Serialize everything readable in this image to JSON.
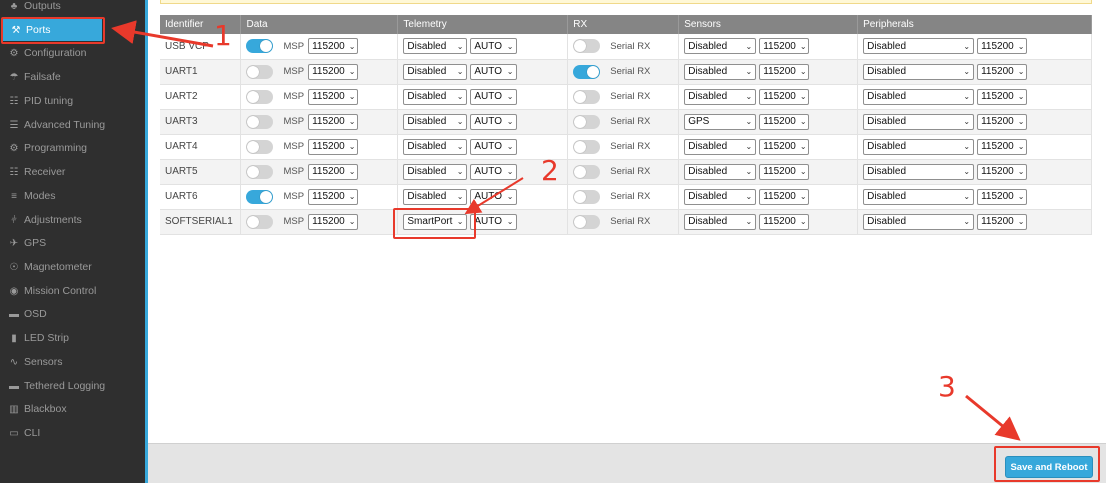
{
  "sidebar": {
    "items": [
      {
        "label": "Outputs",
        "icon": "outputs-icon",
        "glyph": "♣"
      },
      {
        "label": "Ports",
        "icon": "ports-icon",
        "glyph": "⚒",
        "active": true
      },
      {
        "label": "Configuration",
        "icon": "gear-icon",
        "glyph": "⚙"
      },
      {
        "label": "Failsafe",
        "icon": "failsafe-icon",
        "glyph": "☂"
      },
      {
        "label": "PID tuning",
        "icon": "pid-icon",
        "glyph": "☷"
      },
      {
        "label": "Advanced Tuning",
        "icon": "advanced-tuning-icon",
        "glyph": "☰"
      },
      {
        "label": "Programming",
        "icon": "programming-icon",
        "glyph": "⚙"
      },
      {
        "label": "Receiver",
        "icon": "receiver-icon",
        "glyph": "☷"
      },
      {
        "label": "Modes",
        "icon": "modes-icon",
        "glyph": "≡"
      },
      {
        "label": "Adjustments",
        "icon": "adjustments-icon",
        "glyph": "⫩"
      },
      {
        "label": "GPS",
        "icon": "gps-icon",
        "glyph": "✈"
      },
      {
        "label": "Magnetometer",
        "icon": "compass-icon",
        "glyph": "☉"
      },
      {
        "label": "Mission Control",
        "icon": "map-pin-icon",
        "glyph": "◉"
      },
      {
        "label": "OSD",
        "icon": "osd-icon",
        "glyph": "▬"
      },
      {
        "label": "LED Strip",
        "icon": "led-icon",
        "glyph": "▮"
      },
      {
        "label": "Sensors",
        "icon": "sensors-icon",
        "glyph": "∿"
      },
      {
        "label": "Tethered Logging",
        "icon": "logging-icon",
        "glyph": "▬"
      },
      {
        "label": "Blackbox",
        "icon": "blackbox-icon",
        "glyph": "▥"
      },
      {
        "label": "CLI",
        "icon": "cli-icon",
        "glyph": "▭"
      }
    ]
  },
  "table": {
    "headers": [
      "Identifier",
      "Data",
      "Telemetry",
      "RX",
      "Sensors",
      "Peripherals"
    ],
    "msp_label": "MSP",
    "rx_label": "Serial RX",
    "rows": [
      {
        "id": "USB VCP",
        "msp_on": true,
        "msp_baud": "115200",
        "tel": "Disabled",
        "tel_baud": "AUTO",
        "rx_on": false,
        "sens": "Disabled",
        "sens_baud": "115200",
        "per": "Disabled",
        "per_baud": "115200"
      },
      {
        "id": "UART1",
        "msp_on": false,
        "msp_baud": "115200",
        "tel": "Disabled",
        "tel_baud": "AUTO",
        "rx_on": true,
        "sens": "Disabled",
        "sens_baud": "115200",
        "per": "Disabled",
        "per_baud": "115200"
      },
      {
        "id": "UART2",
        "msp_on": false,
        "msp_baud": "115200",
        "tel": "Disabled",
        "tel_baud": "AUTO",
        "rx_on": false,
        "sens": "Disabled",
        "sens_baud": "115200",
        "per": "Disabled",
        "per_baud": "115200"
      },
      {
        "id": "UART3",
        "msp_on": false,
        "msp_baud": "115200",
        "tel": "Disabled",
        "tel_baud": "AUTO",
        "rx_on": false,
        "sens": "GPS",
        "sens_baud": "115200",
        "per": "Disabled",
        "per_baud": "115200"
      },
      {
        "id": "UART4",
        "msp_on": false,
        "msp_baud": "115200",
        "tel": "Disabled",
        "tel_baud": "AUTO",
        "rx_on": false,
        "sens": "Disabled",
        "sens_baud": "115200",
        "per": "Disabled",
        "per_baud": "115200"
      },
      {
        "id": "UART5",
        "msp_on": false,
        "msp_baud": "115200",
        "tel": "Disabled",
        "tel_baud": "AUTO",
        "rx_on": false,
        "sens": "Disabled",
        "sens_baud": "115200",
        "per": "Disabled",
        "per_baud": "115200"
      },
      {
        "id": "UART6",
        "msp_on": true,
        "msp_baud": "115200",
        "tel": "Disabled",
        "tel_baud": "AUTO",
        "rx_on": false,
        "sens": "Disabled",
        "sens_baud": "115200",
        "per": "Disabled",
        "per_baud": "115200"
      },
      {
        "id": "SOFTSERIAL1",
        "msp_on": false,
        "msp_baud": "115200",
        "tel": "SmartPort",
        "tel_baud": "AUTO",
        "rx_on": false,
        "sens": "Disabled",
        "sens_baud": "115200",
        "per": "Disabled",
        "per_baud": "115200"
      }
    ]
  },
  "footer": {
    "save_label": "Save and Reboot"
  },
  "annotations": {
    "n1": "1",
    "n2": "2",
    "n3": "3"
  },
  "colors": {
    "accent": "#37a8db",
    "annotation": "#e8392b",
    "sidebar": "#2f2f2f",
    "header": "#858585"
  }
}
